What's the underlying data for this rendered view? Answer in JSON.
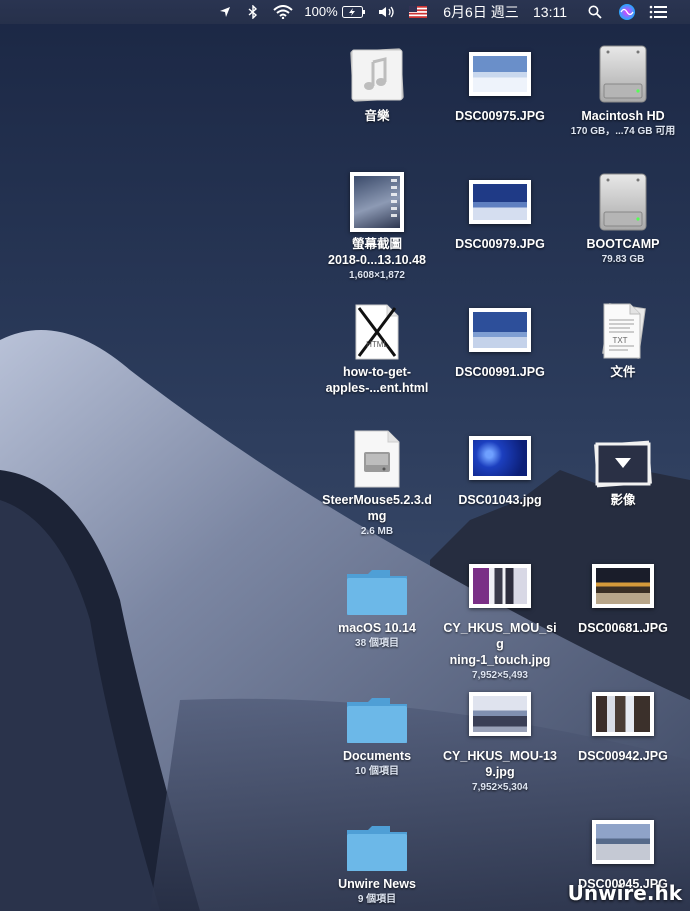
{
  "menubar": {
    "battery_percent": "100%",
    "date": "6月6日 週三",
    "time": "13:11"
  },
  "desktop": {
    "items": [
      {
        "label": "音樂",
        "sub": ""
      },
      {
        "label": "DSC00975.JPG",
        "sub": ""
      },
      {
        "label": "Macintosh HD",
        "sub": "170 GB，...74 GB 可用"
      },
      {
        "label": "螢幕截圖\n2018-0...13.10.48",
        "sub": "1,608×1,872"
      },
      {
        "label": "DSC00979.JPG",
        "sub": ""
      },
      {
        "label": "BOOTCAMP",
        "sub": "79.83 GB"
      },
      {
        "label": "how-to-get-\napples-...ent.html",
        "sub": ""
      },
      {
        "label": "DSC00991.JPG",
        "sub": ""
      },
      {
        "label": "文件",
        "sub": ""
      },
      {
        "label": "SteerMouse5.2.3.d\nmg",
        "sub": "2.6 MB"
      },
      {
        "label": "DSC01043.jpg",
        "sub": ""
      },
      {
        "label": "影像",
        "sub": ""
      },
      {
        "label": "macOS 10.14",
        "sub": "38 個項目"
      },
      {
        "label": "CY_HKUS_MOU_sig\nning-1_touch.jpg",
        "sub": "7,952×5,493"
      },
      {
        "label": "DSC00681.JPG",
        "sub": ""
      },
      {
        "label": "Documents",
        "sub": "10 個項目"
      },
      {
        "label": "CY_HKUS_MOU-13\n9.jpg",
        "sub": "7,952×5,304"
      },
      {
        "label": "DSC00942.JPG",
        "sub": ""
      },
      {
        "label": "Unwire News",
        "sub": "9 個項目"
      },
      {
        "label": "DSC00945.JPG",
        "sub": ""
      }
    ],
    "doc_badges": {
      "html": "HTML",
      "txt": "TXT"
    }
  },
  "watermark": "Unwire.hk"
}
